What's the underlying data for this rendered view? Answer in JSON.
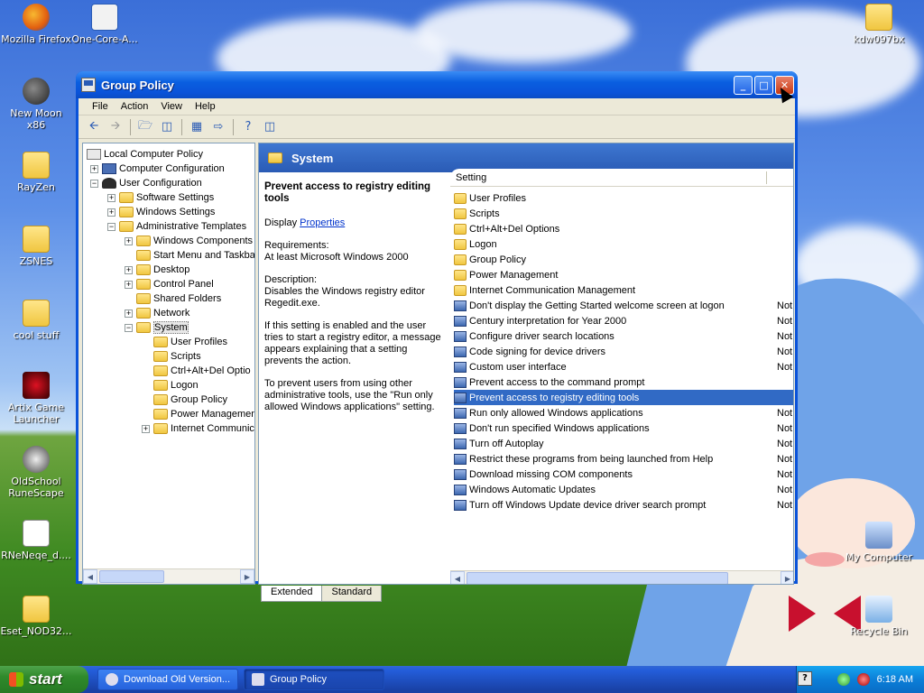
{
  "desktop": {
    "icons_left": [
      {
        "label": "Mozilla Firefox",
        "icon": "firefox-icon"
      },
      {
        "label": "New Moon x86",
        "icon": "newmoon-icon"
      },
      {
        "label": "RayZen",
        "icon": "folder-icon"
      },
      {
        "label": "ZSNES",
        "icon": "folder-icon"
      },
      {
        "label": "cool stuff",
        "icon": "folder-icon"
      },
      {
        "label": "Artix Game Launcher",
        "icon": "artix-icon"
      },
      {
        "label": "OldSchool RuneScape",
        "icon": "runescape-icon"
      },
      {
        "label": "RNeNeqe_d....",
        "icon": "png-file-icon"
      },
      {
        "label": "Eset_NOD32...",
        "icon": "folder-icon"
      }
    ],
    "icons_top": [
      {
        "label": "One-Core-A...",
        "icon": "zip-icon"
      },
      {
        "label": "kdw097bx",
        "icon": "folder-icon"
      }
    ],
    "icons_right": [
      {
        "label": "My Computer",
        "icon": "my-computer-icon"
      },
      {
        "label": "Recycle Bin",
        "icon": "recycle-bin-icon"
      }
    ]
  },
  "window": {
    "title": "Group Policy",
    "controls": {
      "minimize": "_",
      "maximize": "□",
      "close": "✕"
    },
    "menu": [
      "File",
      "Action",
      "View",
      "Help"
    ],
    "toolbar_icons": [
      "back-icon",
      "forward-icon",
      "up-folder-icon",
      "show-hide-tree-icon",
      "properties-icon",
      "export-list-icon",
      "help-icon",
      "show-hide-action-pane-icon"
    ]
  },
  "tree": {
    "items": [
      {
        "label": "Local Computer Policy",
        "icon": "policy",
        "expander": ""
      },
      {
        "label": "Computer Configuration",
        "icon": "comp",
        "expander": "+"
      },
      {
        "label": "User Configuration",
        "icon": "user",
        "expander": "−"
      },
      {
        "label": "Software Settings",
        "icon": "folder",
        "expander": "+"
      },
      {
        "label": "Windows Settings",
        "icon": "folder",
        "expander": "+"
      },
      {
        "label": "Administrative Templates",
        "icon": "folder",
        "expander": "−"
      },
      {
        "label": "Windows Components",
        "icon": "folder",
        "expander": "+"
      },
      {
        "label": "Start Menu and Taskba",
        "icon": "folder",
        "expander": ""
      },
      {
        "label": "Desktop",
        "icon": "folder",
        "expander": "+"
      },
      {
        "label": "Control Panel",
        "icon": "folder",
        "expander": "+"
      },
      {
        "label": "Shared Folders",
        "icon": "folder",
        "expander": ""
      },
      {
        "label": "Network",
        "icon": "folder",
        "expander": "+"
      },
      {
        "label": "System",
        "icon": "folder",
        "expander": "−"
      },
      {
        "label": "User Profiles",
        "icon": "folder",
        "expander": ""
      },
      {
        "label": "Scripts",
        "icon": "folder",
        "expander": ""
      },
      {
        "label": "Ctrl+Alt+Del Optio",
        "icon": "folder",
        "expander": ""
      },
      {
        "label": "Logon",
        "icon": "folder",
        "expander": ""
      },
      {
        "label": "Group Policy",
        "icon": "folder",
        "expander": ""
      },
      {
        "label": "Power Managemen",
        "icon": "folder",
        "expander": ""
      },
      {
        "label": "Internet Communic",
        "icon": "folder",
        "expander": "+"
      }
    ]
  },
  "right": {
    "header": "System",
    "description": {
      "title": "Prevent access to registry editing tools",
      "display_label": "Display",
      "display_link": "Properties",
      "requirements_label": "Requirements:",
      "requirements": "At least Microsoft Windows 2000",
      "description_label": "Description:",
      "description": "Disables the Windows registry editor Regedit.exe.",
      "para1": "If this setting is enabled and the user tries to start a registry editor, a message appears explaining that a setting prevents the action.",
      "para2": "To prevent users from using other administrative tools, use the \"Run only allowed Windows applications\" setting."
    },
    "column_setting": "Setting",
    "rows": [
      {
        "name": "User Profiles",
        "type": "folder",
        "state": ""
      },
      {
        "name": "Scripts",
        "type": "folder",
        "state": ""
      },
      {
        "name": "Ctrl+Alt+Del Options",
        "type": "folder",
        "state": ""
      },
      {
        "name": "Logon",
        "type": "folder",
        "state": ""
      },
      {
        "name": "Group Policy",
        "type": "folder",
        "state": ""
      },
      {
        "name": "Power Management",
        "type": "folder",
        "state": ""
      },
      {
        "name": "Internet Communication Management",
        "type": "folder",
        "state": ""
      },
      {
        "name": "Don't display the Getting Started welcome screen at logon",
        "type": "setting",
        "state": "Not"
      },
      {
        "name": "Century interpretation for Year 2000",
        "type": "setting",
        "state": "Not"
      },
      {
        "name": "Configure driver search locations",
        "type": "setting",
        "state": "Not"
      },
      {
        "name": "Code signing for device drivers",
        "type": "setting",
        "state": "Not"
      },
      {
        "name": "Custom user interface",
        "type": "setting",
        "state": "Not"
      },
      {
        "name": "Prevent access to the command prompt",
        "type": "setting",
        "state": ""
      },
      {
        "name": "Prevent access to registry editing tools",
        "type": "setting",
        "state": "",
        "selected": true
      },
      {
        "name": "Run only allowed Windows applications",
        "type": "setting",
        "state": "Not"
      },
      {
        "name": "Don't run specified Windows applications",
        "type": "setting",
        "state": "Not"
      },
      {
        "name": "Turn off Autoplay",
        "type": "setting",
        "state": "Not"
      },
      {
        "name": "Restrict these programs from being launched from Help",
        "type": "setting",
        "state": "Not"
      },
      {
        "name": "Download missing COM components",
        "type": "setting",
        "state": "Not"
      },
      {
        "name": "Windows Automatic Updates",
        "type": "setting",
        "state": "Not"
      },
      {
        "name": "Turn off Windows Update device driver search prompt",
        "type": "setting",
        "state": "Not"
      }
    ],
    "tabs": [
      "Extended",
      "Standard"
    ]
  },
  "taskbar": {
    "start": "start",
    "buttons": [
      {
        "label": "Download Old Version...",
        "active": false
      },
      {
        "label": "Group Policy",
        "active": true
      }
    ],
    "help": "?",
    "clock": "6:18 AM"
  }
}
